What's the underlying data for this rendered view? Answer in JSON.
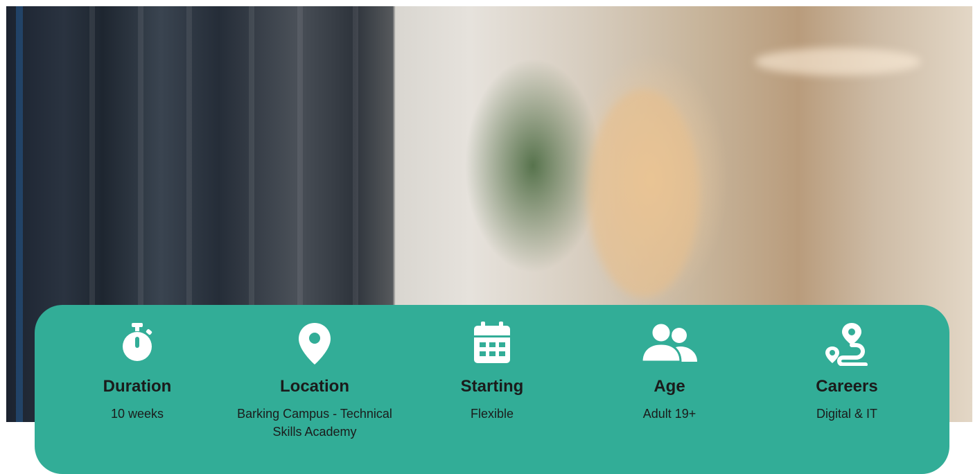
{
  "hero": {
    "image": "photo-two-people-server-room-with-laptop"
  },
  "colors": {
    "card": "#32ad97",
    "icon": "#ffffff",
    "text": "#1b1b1b"
  },
  "items": [
    {
      "icon": "stopwatch-icon",
      "title": "Duration",
      "value": "10 weeks"
    },
    {
      "icon": "location-pin-icon",
      "title": "Location",
      "value": "Barking Campus - Technical Skills Academy"
    },
    {
      "icon": "calendar-icon",
      "title": "Starting",
      "value": "Flexible"
    },
    {
      "icon": "people-icon",
      "title": "Age",
      "value": "Adult 19+"
    },
    {
      "icon": "route-icon",
      "title": "Careers",
      "value": "Digital & IT"
    }
  ]
}
